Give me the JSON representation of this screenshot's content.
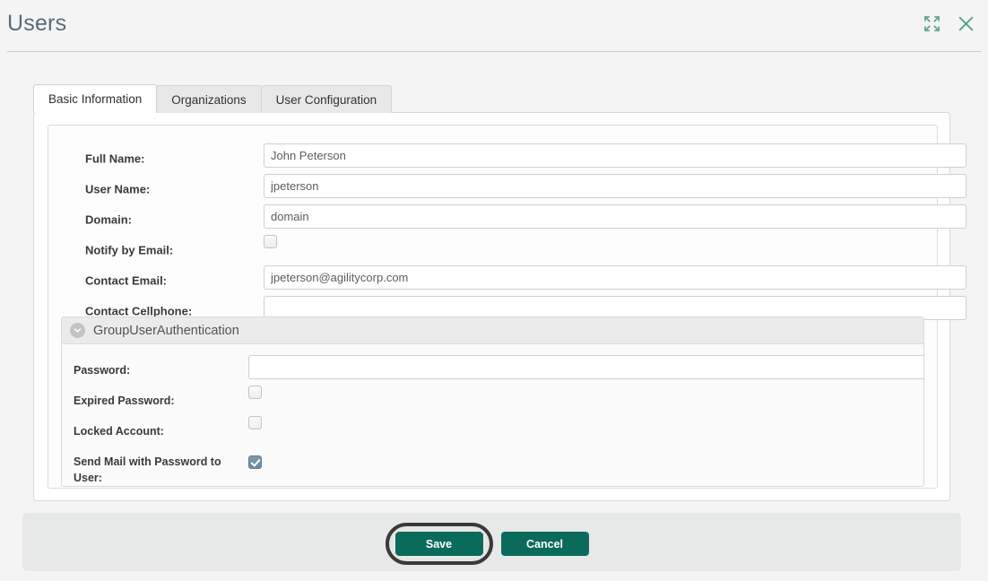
{
  "header": {
    "title": "Users",
    "expand_icon": "expand-fullscreen-icon",
    "close_icon": "close-icon"
  },
  "tabs": [
    {
      "label": "Basic Information",
      "active": true
    },
    {
      "label": "Organizations",
      "active": false
    },
    {
      "label": "User Configuration",
      "active": false
    }
  ],
  "basic_information": {
    "fields": [
      {
        "label": "Full Name:",
        "type": "text",
        "value": "John Peterson"
      },
      {
        "label": "User Name:",
        "type": "text",
        "value": "jpeterson"
      },
      {
        "label": "Domain:",
        "type": "text",
        "value": "domain"
      },
      {
        "label": "Notify by Email:",
        "type": "checkbox",
        "checked": false
      },
      {
        "label": "Contact Email:",
        "type": "text",
        "value": "jpeterson@agilitycorp.com"
      },
      {
        "label": "Contact Cellphone:",
        "type": "text",
        "value": ""
      }
    ]
  },
  "group_panel": {
    "title": "GroupUserAuthentication",
    "toggle_icon": "chevron-down-icon",
    "expanded": true,
    "fields": [
      {
        "label": "Password:",
        "type": "password",
        "value": ""
      },
      {
        "label": "Expired Password:",
        "type": "checkbox",
        "checked": false
      },
      {
        "label": "Locked Account:",
        "type": "checkbox",
        "checked": false
      },
      {
        "label": "Send Mail with Password to User:",
        "type": "checkbox",
        "checked": true
      }
    ]
  },
  "footer": {
    "save_label": "Save",
    "cancel_label": "Cancel"
  },
  "colors": {
    "accent_teal": "#0a6b5c",
    "header_icon": "#57a08e",
    "title_text": "#5a6b7b",
    "checkbox_checked": "#6f8da1",
    "page_background": "#f4f4f4",
    "footer_background": "#e7e8e8"
  }
}
